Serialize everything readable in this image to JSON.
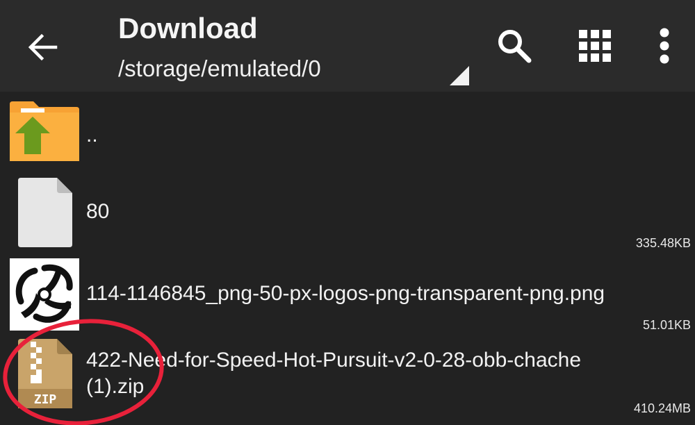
{
  "toolbar": {
    "title": "Download",
    "path": "/storage/emulated/0",
    "back_icon": "arrow-left-icon",
    "search_icon": "search-icon",
    "grid_icon": "grid-view-icon",
    "more_icon": "more-vertical-icon"
  },
  "files": [
    {
      "name": "..",
      "size": "",
      "icon": "folder-up-icon"
    },
    {
      "name": "80",
      "size": "335.48KB",
      "icon": "file-icon"
    },
    {
      "name": "114-1146845_png-50-px-logos-png-transparent-png.png",
      "size": "51.01KB",
      "icon": "image-thumbnail"
    },
    {
      "name_line1": "422-Need-for-Speed-Hot-Pursuit-v2-0-28-obb-chache",
      "name_line2": "(1).zip",
      "size": "410.24MB",
      "icon": "zip-icon",
      "icon_label": "ZIP"
    }
  ],
  "colors": {
    "toolbar_bg": "#2b2b2b",
    "list_bg": "#222222",
    "folder": "#f7a234",
    "up_arrow": "#6b9a1e",
    "annotation": "#e8213a"
  }
}
